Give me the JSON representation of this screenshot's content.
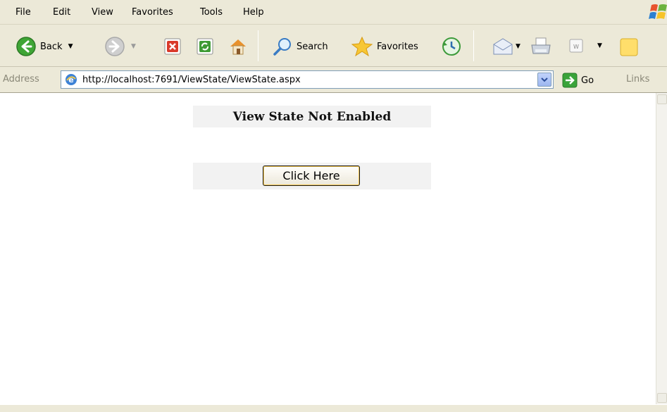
{
  "menu": {
    "items": [
      "File",
      "Edit",
      "View",
      "Favorites",
      "Tools",
      "Help"
    ]
  },
  "toolbar": {
    "back_label": "Back",
    "search_label": "Search",
    "favorites_label": "Favorites"
  },
  "address_bar": {
    "label": "Address",
    "url": "http://localhost:7691/ViewState/ViewState.aspx",
    "go_label": "Go",
    "links_label": "Links"
  },
  "page": {
    "heading": "View State Not Enabled",
    "button_label": "Click Here"
  },
  "icons": {
    "back": "back-arrow-icon",
    "forward": "forward-arrow-icon",
    "stop": "stop-icon",
    "refresh": "refresh-icon",
    "home": "home-icon",
    "search": "search-icon",
    "favorites": "favorites-star-icon",
    "history": "history-icon",
    "mail": "mail-icon",
    "print": "print-icon",
    "edit": "edit-icon",
    "messenger": "messenger-icon"
  },
  "colors": {
    "chrome_bg": "#ece9d8",
    "cell_bg": "#f2f2f2",
    "button_focus": "#f2c54e"
  }
}
